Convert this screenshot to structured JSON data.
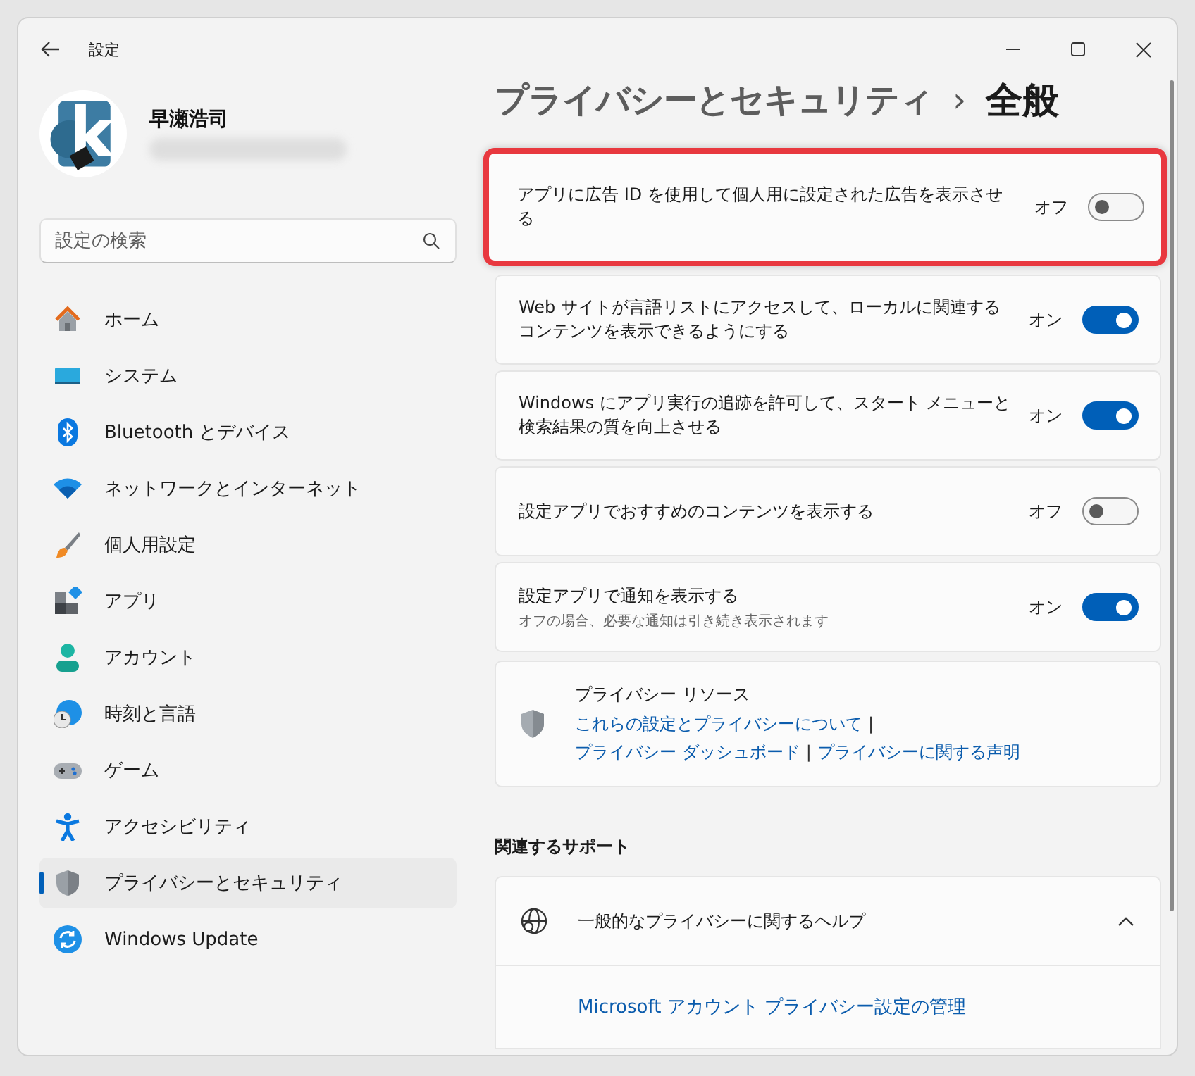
{
  "window": {
    "title": "設定"
  },
  "user": {
    "name": "早瀬浩司"
  },
  "search": {
    "placeholder": "設定の検索"
  },
  "sidebar": {
    "items": [
      {
        "label": "ホーム",
        "kind": "home",
        "selected": false
      },
      {
        "label": "システム",
        "kind": "system",
        "selected": false
      },
      {
        "label": "Bluetooth とデバイス",
        "kind": "bluetooth",
        "selected": false
      },
      {
        "label": "ネットワークとインターネット",
        "kind": "network",
        "selected": false
      },
      {
        "label": "個人用設定",
        "kind": "brush",
        "selected": false
      },
      {
        "label": "アプリ",
        "kind": "apps",
        "selected": false
      },
      {
        "label": "アカウント",
        "kind": "account",
        "selected": false
      },
      {
        "label": "時刻と言語",
        "kind": "time",
        "selected": false
      },
      {
        "label": "ゲーム",
        "kind": "game",
        "selected": false
      },
      {
        "label": "アクセシビリティ",
        "kind": "accessibility",
        "selected": false
      },
      {
        "label": "プライバシーとセキュリティ",
        "kind": "privacy",
        "selected": true
      },
      {
        "label": "Windows Update",
        "kind": "update",
        "selected": false
      }
    ]
  },
  "page": {
    "breadcrumb": "プライバシーとセキュリティ",
    "separator": "›",
    "title": "全般"
  },
  "settings": [
    {
      "label": "アプリに広告 ID を使用して個人用に設定された広告を表示させる",
      "state_label": "オフ",
      "on": false,
      "highlighted": true
    },
    {
      "label": "Web サイトが言語リストにアクセスして、ローカルに関連するコンテンツを表示できるようにする",
      "state_label": "オン",
      "on": true,
      "highlighted": false
    },
    {
      "label": "Windows にアプリ実行の追跡を許可して、スタート メニューと検索結果の質を向上させる",
      "state_label": "オン",
      "on": true,
      "highlighted": false
    },
    {
      "label": "設定アプリでおすすめのコンテンツを表示する",
      "state_label": "オフ",
      "on": false,
      "highlighted": false
    },
    {
      "label": "設定アプリで通知を表示する",
      "description": "オフの場合、必要な通知は引き続き表示されます",
      "state_label": "オン",
      "on": true,
      "highlighted": false
    }
  ],
  "resources": {
    "title": "プライバシー リソース",
    "separator": "|",
    "links": [
      "これらの設定とプライバシーについて",
      "プライバシー ダッシュボード",
      "プライバシーに関する声明"
    ]
  },
  "support": {
    "heading": "関連するサポート",
    "items": [
      {
        "label": "一般的なプライバシーに関するヘルプ",
        "expanded": true,
        "links": [
          "Microsoft アカウント プライバシー設定の管理"
        ]
      }
    ]
  }
}
